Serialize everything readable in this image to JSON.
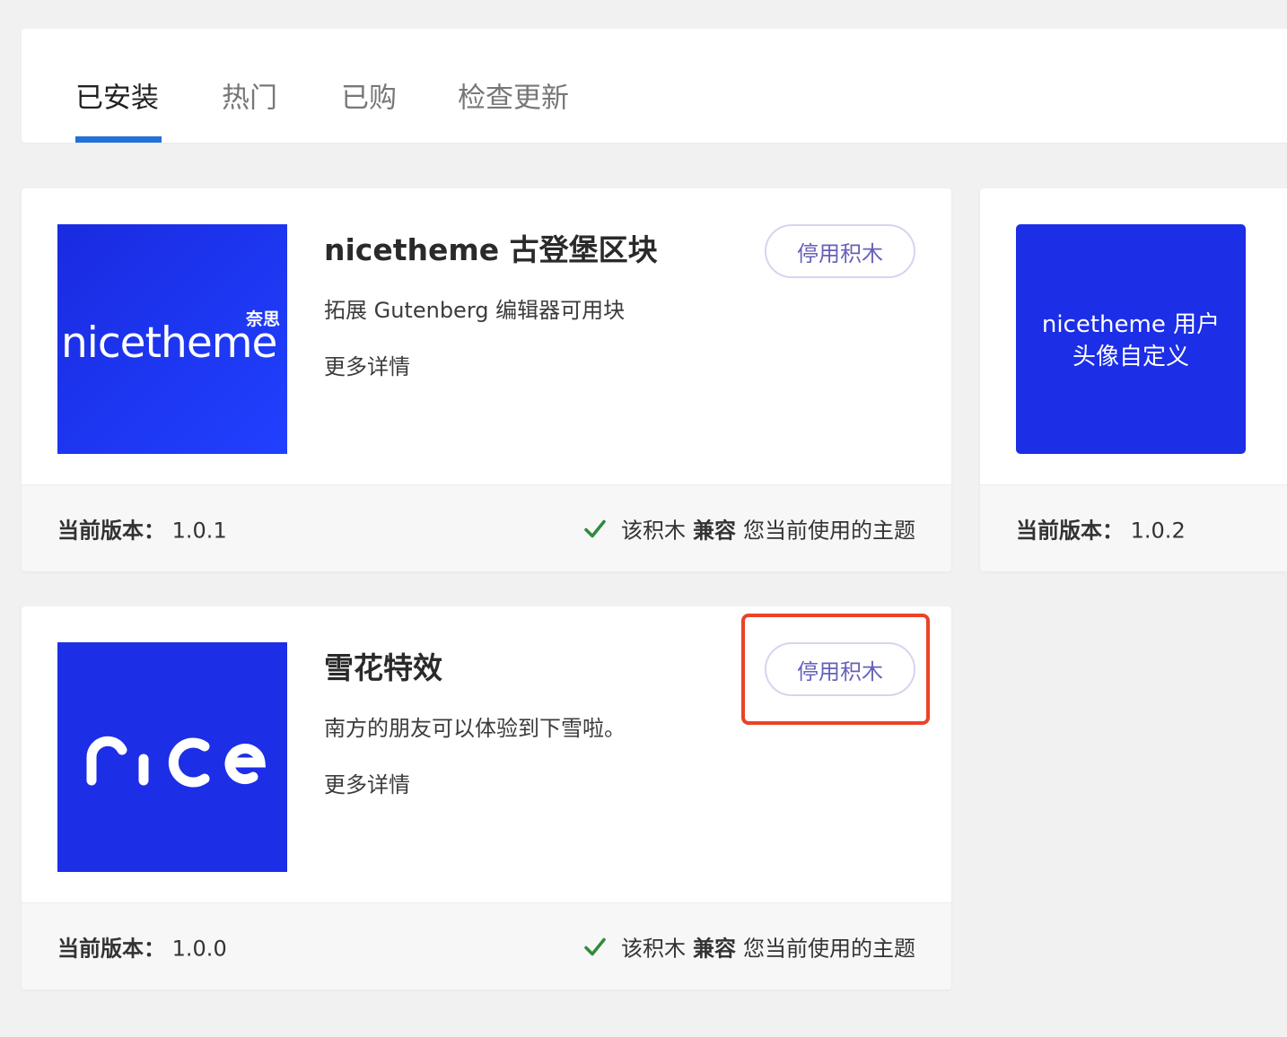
{
  "tabs": [
    {
      "label": "已安装",
      "active": true
    },
    {
      "label": "热门",
      "active": false
    },
    {
      "label": "已购",
      "active": false
    },
    {
      "label": "检查更新",
      "active": false
    }
  ],
  "colors": {
    "accent": "#2271d9",
    "thumb_blue": "#1c2ee6",
    "button_text": "#6760b8",
    "check_green": "#2e8b3a",
    "highlight": "#ea4327"
  },
  "cards": [
    {
      "title": "nicetheme 古登堡区块",
      "description": "拓展 Gutenberg 编辑器可用块",
      "more_label": "更多详情",
      "button_label": "停用积木",
      "logo_text": "nicetheme",
      "logo_cn": "奈思",
      "version_label": "当前版本：",
      "version": "1.0.1",
      "compat_prefix": "该积木",
      "compat_strong": "兼容",
      "compat_suffix": "您当前使用的主题"
    },
    {
      "title": "",
      "thumb_caption_line1": "nicetheme 用户",
      "thumb_caption_line2": "头像自定义",
      "version_label": "当前版本：",
      "version": "1.0.2"
    },
    {
      "title": "雪花特效",
      "description": "南方的朋友可以体验到下雪啦。",
      "more_label": "更多详情",
      "button_label": "停用积木",
      "logo_text": "nice",
      "version_label": "当前版本：",
      "version": "1.0.0",
      "compat_prefix": "该积木",
      "compat_strong": "兼容",
      "compat_suffix": "您当前使用的主题"
    }
  ]
}
